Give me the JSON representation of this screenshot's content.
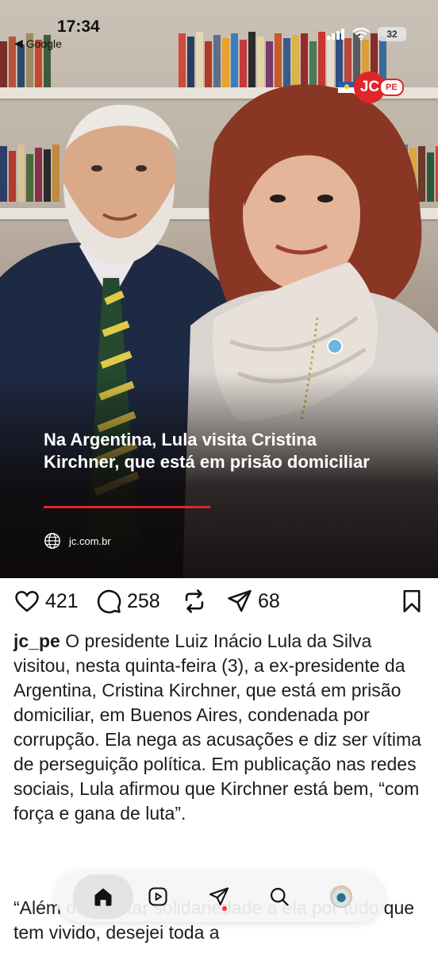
{
  "status_bar": {
    "time": "17:34",
    "back_app": "Google",
    "battery": "32"
  },
  "post": {
    "brand": {
      "badge": "JC",
      "pill": "PE"
    },
    "headline": "Na Argentina, Lula visita Cristina Kirchner, que está em prisão domiciliar",
    "source": "jc.com.br",
    "colors": {
      "accent": "#e0262b",
      "nav_dot": "#ff3040"
    }
  },
  "actions": {
    "likes": "421",
    "comments": "258",
    "shares": "68"
  },
  "caption": {
    "username": "jc_pe",
    "text": "O presidente Luiz Inácio Lula da Silva visitou, nesta quinta-feira (3), a ex-presidente da Argentina, Cristina Kirchner, que está em prisão domiciliar, em Buenos Aires, condenada por corrupção. Ela nega as acusações e diz ser vítima de perseguição política. Em publicação nas redes sociais, Lula afirmou que Kirchner está bem, “com força e gana de luta”.",
    "continuation": "“Além de prestar solidariedade a ela por tudo que tem vivido, desejei toda a"
  },
  "nav": {
    "items": [
      "home-icon",
      "reels-icon",
      "send-icon",
      "search-icon",
      "profile-avatar"
    ]
  }
}
